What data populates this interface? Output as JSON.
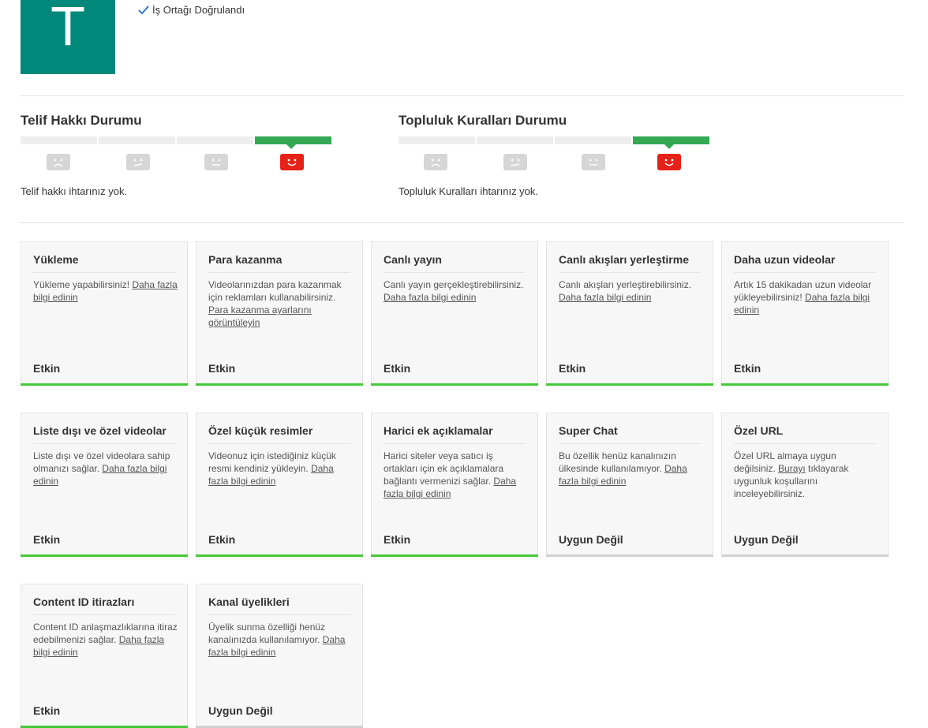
{
  "channel": {
    "avatar_letter": "T",
    "partner_label": "İş Ortağı Doğrulandı"
  },
  "copyright": {
    "title": "Telif Hakkı Durumu",
    "message": "Telif hakkı ihtarınız yok."
  },
  "community": {
    "title": "Topluluk Kuralları Durumu",
    "message": "Topluluk Kuralları ihtarınız yok."
  },
  "colors": {
    "avatar": "#00897b",
    "active_bar": "#44c936",
    "inactive_bar": "#d0d0d0",
    "face_active": "#e62117"
  },
  "features": [
    {
      "title": "Yükleme",
      "text": "Yükleme yapabilirsiniz! ",
      "link": "Daha fazla bilgi edinin",
      "tail": "",
      "status": "Etkin"
    },
    {
      "title": "Para kazanma",
      "text": "Videolarınızdan para kazanmak için reklamları kullanabilirsiniz. ",
      "link": "Para kazanma ayarlarını görüntüleyin",
      "tail": "",
      "status": "Etkin"
    },
    {
      "title": "Canlı yayın",
      "text": "Canlı yayın gerçekleştirebilirsiniz. ",
      "link": "Daha fazla bilgi edinin",
      "tail": "",
      "status": "Etkin"
    },
    {
      "title": "Canlı akışları yerleştirme",
      "text": "Canlı akışları yerleştirebilirsiniz. ",
      "link": "Daha fazla bilgi edinin",
      "tail": "",
      "status": "Etkin"
    },
    {
      "title": "Daha uzun videolar",
      "text": "Artık 15 dakikadan uzun videolar yükleyebilirsiniz! ",
      "link": "Daha fazla bilgi edinin",
      "tail": "",
      "status": "Etkin"
    },
    {
      "title": "Liste dışı ve özel videolar",
      "text": "Liste dışı ve özel videolara sahip olmanızı sağlar. ",
      "link": "Daha fazla bilgi edinin",
      "tail": "",
      "status": "Etkin"
    },
    {
      "title": "Özel küçük resimler",
      "text": "Videonuz için istediğiniz küçük resmi kendiniz yükleyin. ",
      "link": "Daha fazla bilgi edinin",
      "tail": "",
      "status": "Etkin"
    },
    {
      "title": "Harici ek açıklamalar",
      "text": "Harici siteler veya satıcı iş ortakları için ek açıklamalara bağlantı vermenizi sağlar. ",
      "link": "Daha fazla bilgi edinin",
      "tail": "",
      "status": "Etkin"
    },
    {
      "title": "Super Chat",
      "text": "Bu özellik henüz kanalınızın ülkesinde kullanılamıyor. ",
      "link": "Daha fazla bilgi edinin",
      "tail": "",
      "status": "Uygun Değil"
    },
    {
      "title": "Özel URL",
      "text": "Özel URL almaya uygun değilsiniz. ",
      "link": "Burayı",
      "tail": " tıklayarak uygunluk koşullarını inceleyebilirsiniz.",
      "status": "Uygun Değil"
    },
    {
      "title": "Content ID itirazları",
      "text": "Content ID anlaşmazlıklarına itiraz edebilmenizi sağlar. ",
      "link": "Daha fazla bilgi edinin",
      "tail": "",
      "status": "Etkin"
    },
    {
      "title": "Kanal üyelikleri",
      "text": "Üyelik sunma özelliği henüz kanalınızda kullanılamıyor. ",
      "link": "Daha fazla bilgi edinin",
      "tail": "",
      "status": "Uygun Değil"
    }
  ]
}
